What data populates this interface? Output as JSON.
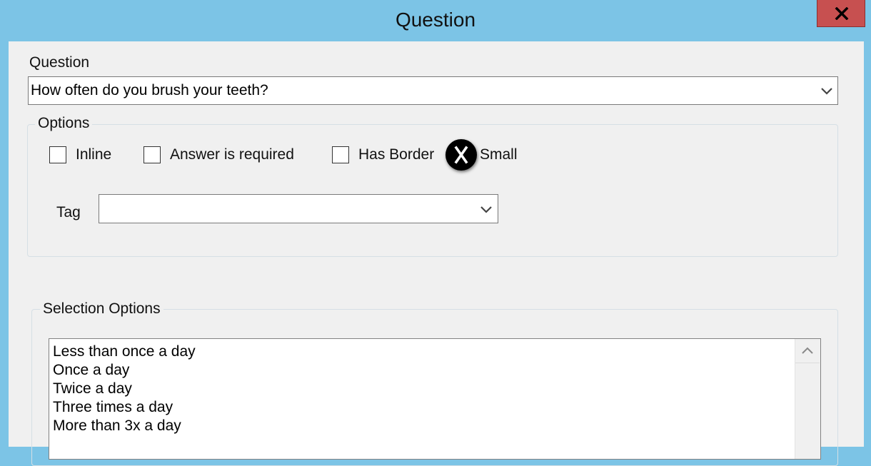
{
  "window": {
    "title": "Question",
    "close_icon": "close-x-icon"
  },
  "question": {
    "label": "Question",
    "value": "How often do you brush your teeth?"
  },
  "options": {
    "legend": "Options",
    "checkboxes": [
      {
        "label": "Inline",
        "checked": false
      },
      {
        "label": "Answer is required",
        "checked": false
      },
      {
        "label": "Has Border",
        "checked": false
      },
      {
        "label": "Small",
        "checked": false
      }
    ],
    "tag_label": "Tag",
    "tag_value": ""
  },
  "selection_options": {
    "legend": "Selection Options",
    "items": [
      "Less than once a day",
      "Once a day",
      "Twice a day",
      "Three times a day",
      "More than 3x a day"
    ]
  },
  "colors": {
    "titlebar": "#7cc4e6",
    "close_button": "#c75050",
    "dialog_background": "#f0f0f0"
  }
}
